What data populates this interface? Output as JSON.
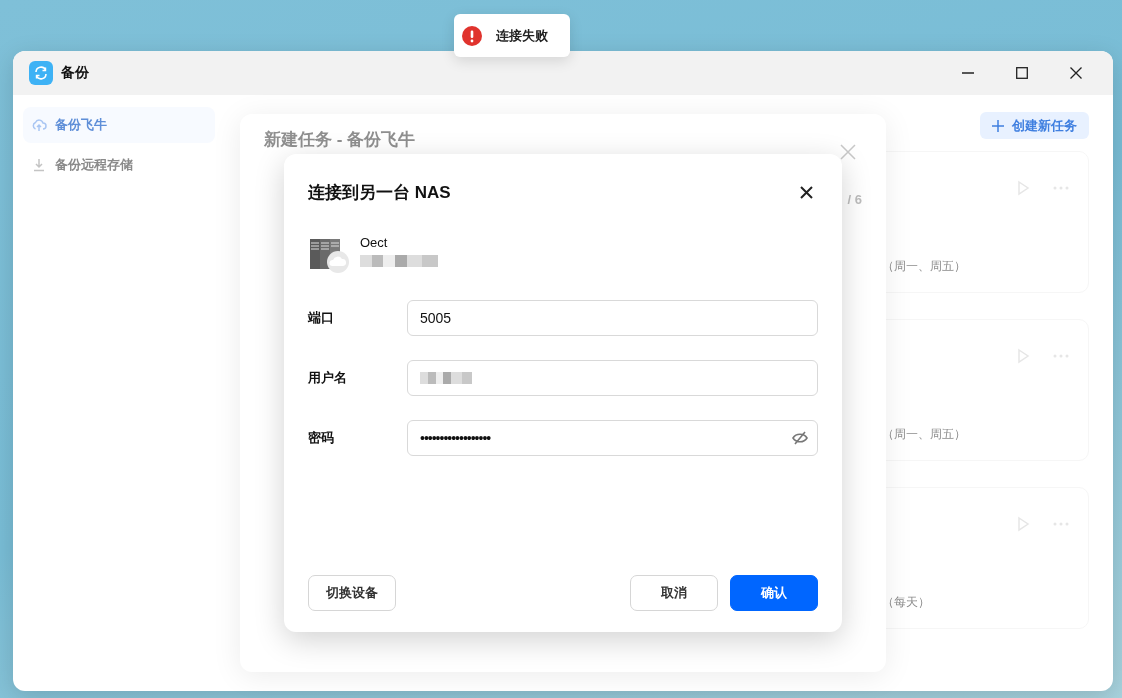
{
  "toast": {
    "kind": "error",
    "message": "连接失败"
  },
  "window": {
    "title": "备份"
  },
  "sidebar": {
    "items": [
      {
        "label": "备份飞牛",
        "selected": true
      },
      {
        "label": "备份远程存储",
        "selected": false
      }
    ]
  },
  "toolbar": {
    "create_button": "创建新任务"
  },
  "tasks": [
    {
      "schedule": "（周一、周五）"
    },
    {
      "schedule": "（周一、周五）"
    },
    {
      "schedule": "（每天）"
    }
  ],
  "task_dialog": {
    "title": "新建任务 - 备份飞牛",
    "step": "/ 6"
  },
  "connect_dialog": {
    "title": "连接到另一台 NAS",
    "device": {
      "name": "Oect",
      "address_redacted": true
    },
    "fields": [
      {
        "label": "端口",
        "kind": "text",
        "value": "5005"
      },
      {
        "label": "用户名",
        "kind": "redacted"
      },
      {
        "label": "密码",
        "kind": "password",
        "value": "••••••••••••••••••",
        "revealed": false
      }
    ],
    "switch_button": "切换设备",
    "buttons": [
      {
        "label": "取消",
        "primary": false
      },
      {
        "label": "确认",
        "primary": true
      }
    ]
  }
}
